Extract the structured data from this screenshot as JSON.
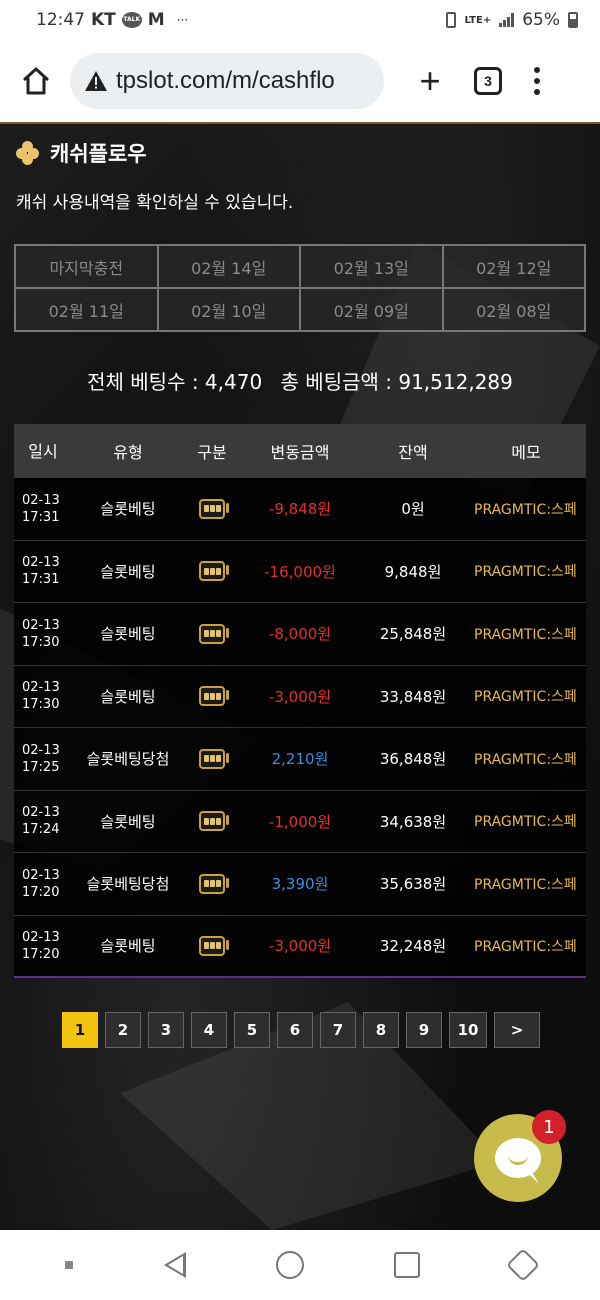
{
  "status_bar": {
    "time": "12:47",
    "carrier": "KT",
    "talk_label": "TALK",
    "mail_label": "M",
    "more": "···",
    "network": "LTE+",
    "battery": "65%"
  },
  "browser": {
    "url": "tpslot.com/m/cashflo",
    "tab_count": "3"
  },
  "page": {
    "title": "캐쉬플로우",
    "description": "캐쉬 사용내역을 확인하실 수 있습니다.",
    "date_tabs": [
      "마지막충전",
      "02월 14일",
      "02월 13일",
      "02월 12일",
      "02월 11일",
      "02월 10일",
      "02월 09일",
      "02월 08일"
    ],
    "totals": {
      "bet_count_label": "전체 베팅수 : 4,470",
      "bet_amount_label": "총 베팅금액 : 91,512,289"
    },
    "table": {
      "headers": [
        "일시",
        "유형",
        "구분",
        "변동금액",
        "잔액",
        "메모"
      ],
      "rows": [
        {
          "date": "02-13",
          "time": "17:31",
          "type": "슬롯베팅",
          "category_icon": "slot-machine-icon",
          "amount": "-9,848원",
          "balance": "0원",
          "memo": "PRAGMTIC:스페"
        },
        {
          "date": "02-13",
          "time": "17:31",
          "type": "슬롯베팅",
          "category_icon": "slot-machine-icon",
          "amount": "-16,000원",
          "balance": "9,848원",
          "memo": "PRAGMTIC:스페"
        },
        {
          "date": "02-13",
          "time": "17:30",
          "type": "슬롯베팅",
          "category_icon": "slot-machine-icon",
          "amount": "-8,000원",
          "balance": "25,848원",
          "memo": "PRAGMTIC:스페"
        },
        {
          "date": "02-13",
          "time": "17:30",
          "type": "슬롯베팅",
          "category_icon": "slot-machine-icon",
          "amount": "-3,000원",
          "balance": "33,848원",
          "memo": "PRAGMTIC:스페"
        },
        {
          "date": "02-13",
          "time": "17:25",
          "type": "슬롯베팅당첨",
          "category_icon": "slot-machine-icon",
          "amount": "2,210원",
          "balance": "36,848원",
          "memo": "PRAGMTIC:스페"
        },
        {
          "date": "02-13",
          "time": "17:24",
          "type": "슬롯베팅",
          "category_icon": "slot-machine-icon",
          "amount": "-1,000원",
          "balance": "34,638원",
          "memo": "PRAGMTIC:스페"
        },
        {
          "date": "02-13",
          "time": "17:20",
          "type": "슬롯베팅당첨",
          "category_icon": "slot-machine-icon",
          "amount": "3,390원",
          "balance": "35,638원",
          "memo": "PRAGMTIC:스페"
        },
        {
          "date": "02-13",
          "time": "17:20",
          "type": "슬롯베팅",
          "category_icon": "slot-machine-icon",
          "amount": "-3,000원",
          "balance": "32,248원",
          "memo": "PRAGMTIC:스페"
        }
      ]
    },
    "pagination": {
      "pages": [
        "1",
        "2",
        "3",
        "4",
        "5",
        "6",
        "7",
        "8",
        "9",
        "10"
      ],
      "active": "1",
      "next_label": ">"
    },
    "chat": {
      "badge": "1"
    }
  },
  "colors": {
    "accent_gold": "#f2c30f",
    "negative": "#e03030",
    "positive": "#3a8de0",
    "memo": "#e9b949",
    "chat_button": "#c7bb4b"
  }
}
